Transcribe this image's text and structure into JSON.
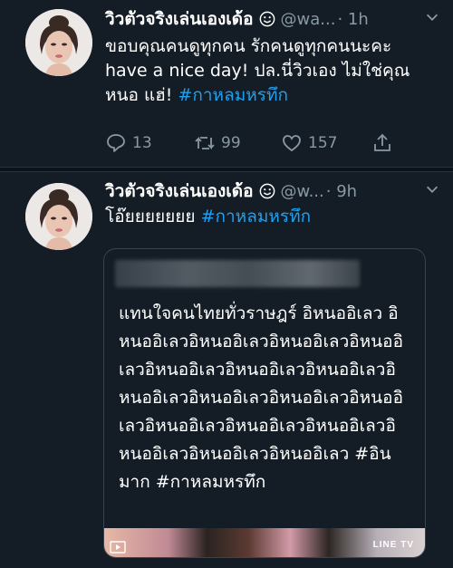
{
  "tweets": [
    {
      "display_name": "วิวตัวจริงเล่นเองเด้อ",
      "handle": "@wa...",
      "time": "· 1h",
      "text": "ขอบคุณคนดูทุกคน รักคนดูทุกคนนะคะ have a nice day! ปล.นี่วิวเอง ไม่ใช่คุณหนอ แฮ่! ",
      "hashtag": "#กาหลมหรทึก",
      "replies": "13",
      "retweets": "99",
      "likes": "157"
    },
    {
      "display_name": "วิวตัวจริงเล่นเองเด้อ",
      "handle": "@w...",
      "time": "· 9h",
      "text": "โอ๊ยยยยยยย ",
      "hashtag": "#กาหลมหรทึก",
      "quote": {
        "text": "แทนใจคนไทยทั่วราษฎร์ อิหนออิเลว อิหนออิเลวอิหนออิเลวอิหนออิเลวอิหนออิเลวอิหนออิเลวอิหนออิเลวอิหนออิเลวอิหนออิเลวอิหนออิเลวอิหนออิเลวอิหนออิเลวอิหนออิเลวอิหนออิเลวอิหนออิเลวอิหนออิเลวอิหนออิเลวอิหนออิเลว #อินมาก  #กาหลมหรทึก",
        "media_brand": "LINE TV"
      }
    }
  ],
  "icons": [
    "smile-emoji-icon",
    "chevron-down-icon",
    "reply-icon",
    "retweet-icon",
    "like-icon",
    "share-icon",
    "media-icon"
  ],
  "colors": {
    "background": "#141d26",
    "secondary_text": "#8899a6",
    "link": "#1da1f2"
  }
}
